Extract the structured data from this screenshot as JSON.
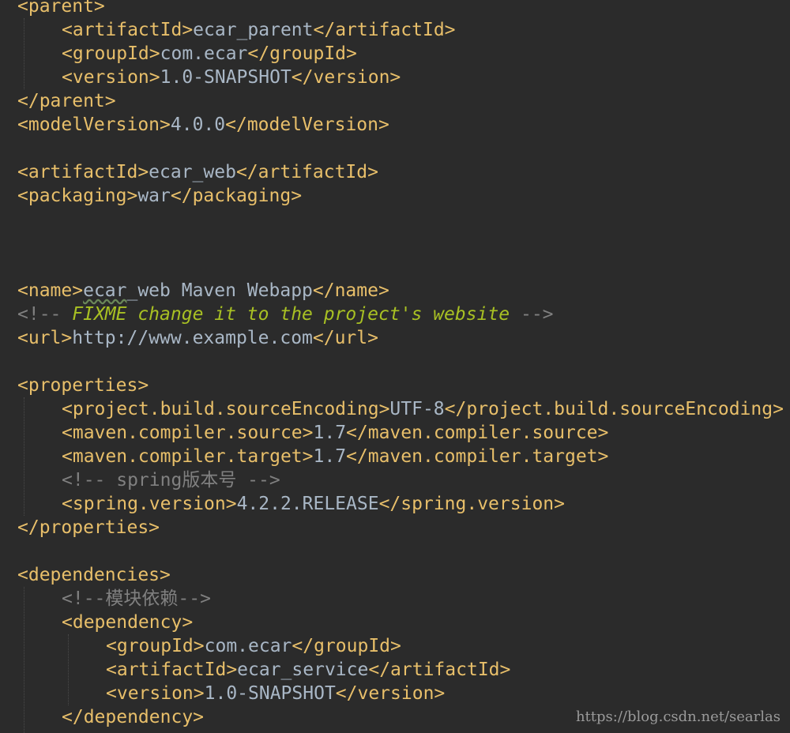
{
  "lines": [
    {
      "indent": 0,
      "parts": [
        {
          "t": "tag",
          "v": "<parent>"
        }
      ]
    },
    {
      "indent": 1,
      "parts": [
        {
          "t": "tag",
          "v": "<artifactId>"
        },
        {
          "t": "txt",
          "v": "ecar_parent"
        },
        {
          "t": "tag",
          "v": "</artifactId>"
        }
      ]
    },
    {
      "indent": 1,
      "parts": [
        {
          "t": "tag",
          "v": "<groupId>"
        },
        {
          "t": "txt",
          "v": "com.ecar"
        },
        {
          "t": "tag",
          "v": "</groupId>"
        }
      ]
    },
    {
      "indent": 1,
      "parts": [
        {
          "t": "tag",
          "v": "<version>"
        },
        {
          "t": "txt",
          "v": "1.0-SNAPSHOT"
        },
        {
          "t": "tag",
          "v": "</version>"
        }
      ]
    },
    {
      "indent": 0,
      "parts": [
        {
          "t": "tag",
          "v": "</parent>"
        }
      ]
    },
    {
      "indent": 0,
      "parts": [
        {
          "t": "tag",
          "v": "<modelVersion>"
        },
        {
          "t": "txt",
          "v": "4.0.0"
        },
        {
          "t": "tag",
          "v": "</modelVersion>"
        }
      ]
    },
    {
      "indent": 0,
      "parts": []
    },
    {
      "indent": 0,
      "parts": [
        {
          "t": "tag",
          "v": "<artifactId>"
        },
        {
          "t": "txt",
          "v": "ecar_web"
        },
        {
          "t": "tag",
          "v": "</artifactId>"
        }
      ]
    },
    {
      "indent": 0,
      "parts": [
        {
          "t": "tag",
          "v": "<packaging>"
        },
        {
          "t": "txt",
          "v": "war"
        },
        {
          "t": "tag",
          "v": "</packaging>"
        }
      ]
    },
    {
      "indent": 0,
      "parts": []
    },
    {
      "indent": 0,
      "parts": []
    },
    {
      "indent": 0,
      "parts": []
    },
    {
      "indent": 0,
      "parts": [
        {
          "t": "tag",
          "v": "<name>"
        },
        {
          "t": "txt squiggle",
          "v": "ecar"
        },
        {
          "t": "txt",
          "v": "_web Maven Webapp"
        },
        {
          "t": "tag",
          "v": "</name>"
        }
      ]
    },
    {
      "indent": 0,
      "parts": [
        {
          "t": "cmt",
          "v": "<!-- "
        },
        {
          "t": "todo",
          "v": "FIXME change it to the project's website"
        },
        {
          "t": "cmt",
          "v": " -->"
        }
      ]
    },
    {
      "indent": 0,
      "parts": [
        {
          "t": "tag",
          "v": "<url>"
        },
        {
          "t": "txt",
          "v": "http://www.example.com"
        },
        {
          "t": "tag",
          "v": "</url>"
        }
      ]
    },
    {
      "indent": 0,
      "parts": []
    },
    {
      "indent": 0,
      "parts": [
        {
          "t": "tag",
          "v": "<properties>"
        }
      ]
    },
    {
      "indent": 1,
      "parts": [
        {
          "t": "tag",
          "v": "<project.build.sourceEncoding>"
        },
        {
          "t": "txt",
          "v": "UTF-8"
        },
        {
          "t": "tag",
          "v": "</project.build.sourceEncoding>"
        }
      ]
    },
    {
      "indent": 1,
      "parts": [
        {
          "t": "tag",
          "v": "<maven.compiler.source>"
        },
        {
          "t": "txt",
          "v": "1.7"
        },
        {
          "t": "tag",
          "v": "</maven.compiler.source>"
        }
      ]
    },
    {
      "indent": 1,
      "parts": [
        {
          "t": "tag",
          "v": "<maven.compiler.target>"
        },
        {
          "t": "txt",
          "v": "1.7"
        },
        {
          "t": "tag",
          "v": "</maven.compiler.target>"
        }
      ]
    },
    {
      "indent": 1,
      "parts": [
        {
          "t": "cmt",
          "v": "<!-- spring版本号 -->"
        }
      ]
    },
    {
      "indent": 1,
      "parts": [
        {
          "t": "tag",
          "v": "<spring.version>"
        },
        {
          "t": "txt",
          "v": "4.2.2.RELEASE"
        },
        {
          "t": "tag",
          "v": "</spring.version>"
        }
      ]
    },
    {
      "indent": 0,
      "parts": [
        {
          "t": "tag",
          "v": "</properties>"
        }
      ]
    },
    {
      "indent": 0,
      "parts": []
    },
    {
      "indent": 0,
      "parts": [
        {
          "t": "tag",
          "v": "<dependencies>"
        }
      ]
    },
    {
      "indent": 1,
      "parts": [
        {
          "t": "cmt",
          "v": "<!--模块依赖-->"
        }
      ]
    },
    {
      "indent": 1,
      "parts": [
        {
          "t": "tag",
          "v": "<dependency>"
        }
      ]
    },
    {
      "indent": 2,
      "parts": [
        {
          "t": "tag",
          "v": "<groupId>"
        },
        {
          "t": "txt",
          "v": "com.ecar"
        },
        {
          "t": "tag",
          "v": "</groupId>"
        }
      ]
    },
    {
      "indent": 2,
      "parts": [
        {
          "t": "tag",
          "v": "<artifactId>"
        },
        {
          "t": "txt",
          "v": "ecar_service"
        },
        {
          "t": "tag",
          "v": "</artifactId>"
        }
      ]
    },
    {
      "indent": 2,
      "parts": [
        {
          "t": "tag",
          "v": "<version>"
        },
        {
          "t": "txt",
          "v": "1.0-SNAPSHOT"
        },
        {
          "t": "tag",
          "v": "</version>"
        }
      ]
    },
    {
      "indent": 1,
      "parts": [
        {
          "t": "tag",
          "v": "</dependency>"
        }
      ]
    }
  ],
  "watermark": "https://blog.csdn.net/searlas",
  "colors": {
    "background": "#2b2b2b",
    "tag": "#e8bf6a",
    "text": "#a9b7c6",
    "comment": "#808080",
    "todo": "#a8c023"
  }
}
